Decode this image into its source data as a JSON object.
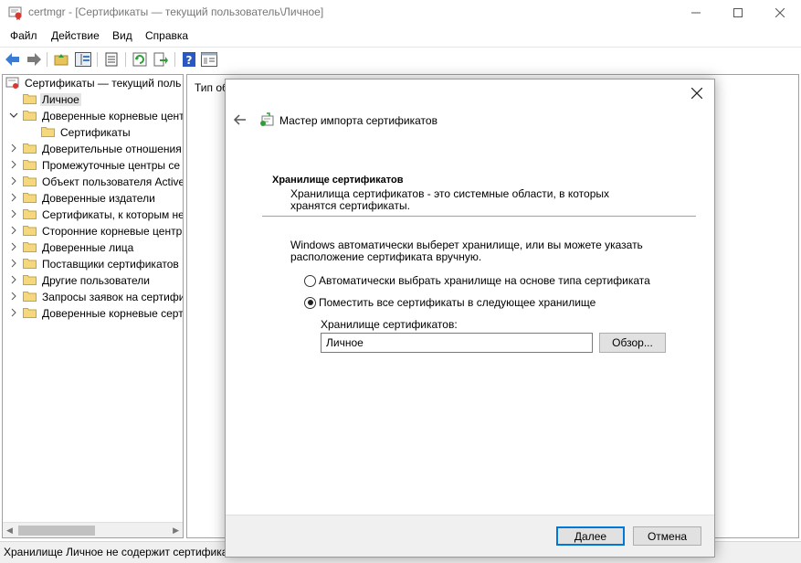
{
  "window": {
    "title": "certmgr - [Сертификаты — текущий пользователь\\Личное]"
  },
  "menu": [
    "Файл",
    "Действие",
    "Вид",
    "Справка"
  ],
  "toolbar": {
    "icons": [
      "back-arrow-icon",
      "forward-arrow-icon",
      "up-folder-icon",
      "show-hide-tree-icon",
      "export-list-icon",
      "refresh-icon",
      "export-icon",
      "help-icon",
      "properties-view-icon"
    ]
  },
  "tree": {
    "root": "Сертификаты — текущий поль",
    "items": [
      {
        "label": "Личное",
        "selected": true,
        "level": 1,
        "arrow": ""
      },
      {
        "label": "Доверенные корневые цент",
        "level": 1,
        "arrow": "expanded"
      },
      {
        "label": "Сертификаты",
        "level": 2,
        "arrow": ""
      },
      {
        "label": "Доверительные отношения",
        "level": 1,
        "arrow": "collapsed"
      },
      {
        "label": "Промежуточные центры се",
        "level": 1,
        "arrow": "collapsed"
      },
      {
        "label": "Объект пользователя Active",
        "level": 1,
        "arrow": "collapsed"
      },
      {
        "label": "Доверенные издатели",
        "level": 1,
        "arrow": "collapsed"
      },
      {
        "label": "Сертификаты, к которым не",
        "level": 1,
        "arrow": "collapsed"
      },
      {
        "label": "Сторонние корневые центр",
        "level": 1,
        "arrow": "collapsed"
      },
      {
        "label": "Доверенные лица",
        "level": 1,
        "arrow": "collapsed"
      },
      {
        "label": "Поставщики сертификатов",
        "level": 1,
        "arrow": "collapsed"
      },
      {
        "label": "Другие пользователи",
        "level": 1,
        "arrow": "collapsed"
      },
      {
        "label": "Запросы заявок на сертифи",
        "level": 1,
        "arrow": "collapsed"
      },
      {
        "label": "Доверенные корневые серт",
        "level": 1,
        "arrow": "collapsed"
      }
    ]
  },
  "right_panel": {
    "column_header": "Тип об"
  },
  "status": {
    "text": "Хранилище Личное не содержит сертифика"
  },
  "dialog": {
    "title": "Мастер импорта сертификатов",
    "section_title": "Хранилище сертификатов",
    "section_desc": "Хранилища сертификатов - это системные области, в которых хранятся сертификаты.",
    "info": "Windows автоматически выберет хранилище, или вы можете указать расположение сертификата вручную.",
    "radio_auto": "Автоматически выбрать хранилище на основе типа сертификата",
    "radio_manual": "Поместить все сертификаты в следующее хранилище",
    "selected_option": "manual",
    "store_label": "Хранилище сертификатов:",
    "store_value": "Личное",
    "browse": "Обзор...",
    "next": "Далее",
    "cancel": "Отмена"
  },
  "colors": {
    "accent": "#0078d7",
    "folder": "#f5d77e",
    "back_arrow": "#3a7bd5"
  }
}
